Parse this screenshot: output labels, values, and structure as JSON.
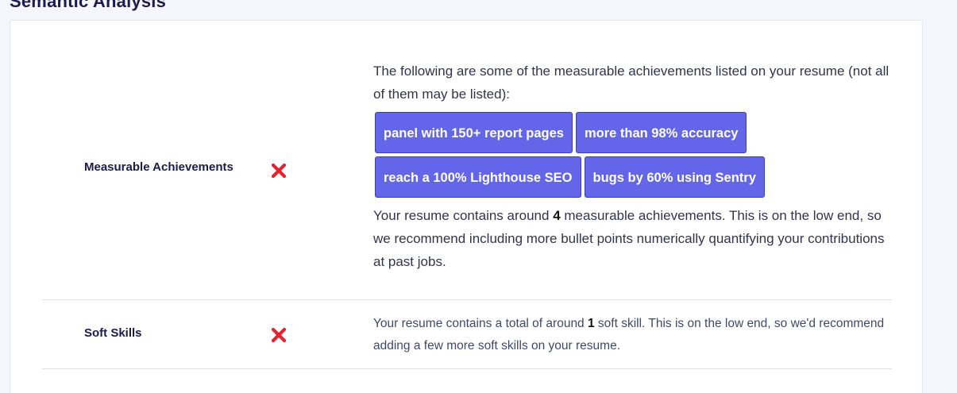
{
  "section": {
    "title": "Semantic Analysis"
  },
  "rows": {
    "achievements": {
      "label": "Measurable Achievements",
      "status_icon": "red-x-icon",
      "intro": "The following are some of the measurable achievements listed on your resume (not all of them may be listed):",
      "chips": [
        "panel with 150+ report pages",
        "more than 98% accuracy",
        "reach a 100% Lighthouse SEO",
        "bugs by 60% using Sentry"
      ],
      "summary_prefix": "Your resume contains around ",
      "count": "4",
      "summary_suffix": " measurable achievements. This is on the low end, so we recommend including more bullet points numerically quantifying your contributions at past jobs."
    },
    "soft_skills": {
      "label": "Soft Skills",
      "status_icon": "red-x-icon",
      "summary_prefix": "Your resume contains a total of around ",
      "count": "1",
      "summary_suffix": " soft skill. This is on the low end, so we'd recommend adding a few more soft skills on your resume."
    }
  },
  "colors": {
    "chip_bg": "#6366e8",
    "chip_border": "#3b3fb6",
    "status_fail": "#e5232f",
    "heading": "#1c1b4b"
  }
}
